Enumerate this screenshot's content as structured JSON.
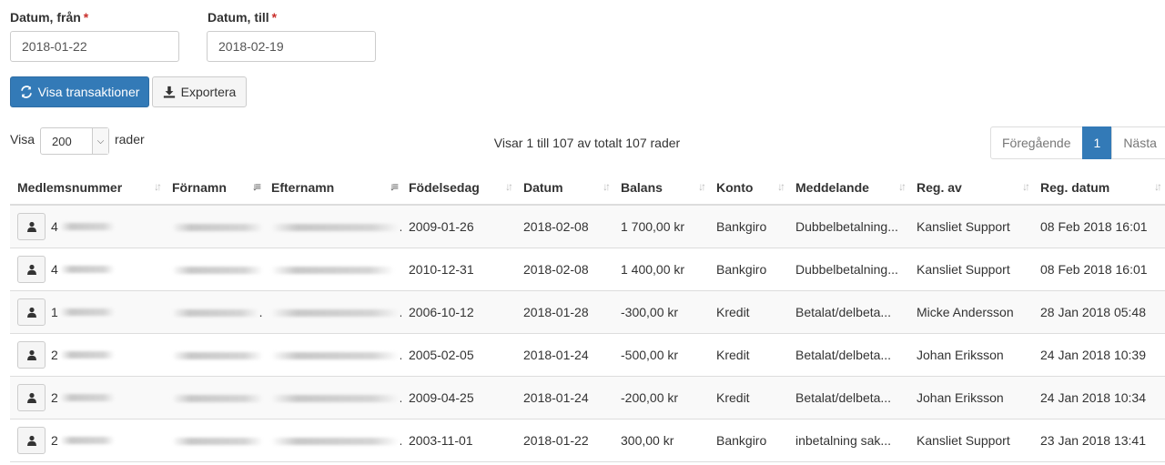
{
  "filters": {
    "from_label": "Datum, från",
    "from_value": "2018-01-22",
    "to_label": "Datum, till",
    "to_value": "2018-02-19",
    "required_mark": "*"
  },
  "actions": {
    "show_label": "Visa transaktioner",
    "export_label": "Exportera"
  },
  "table_controls": {
    "show_prefix": "Visa",
    "page_length": "200",
    "show_suffix": "rader",
    "info": "Visar 1 till 107 av totalt 107 rader",
    "prev": "Föregående",
    "page": "1",
    "next": "Nästa"
  },
  "columns": {
    "member_no": "Medlemsnummer",
    "first_name": "Förnamn",
    "last_name": "Efternamn",
    "birth_date": "Födelsedag",
    "date": "Datum",
    "balance": "Balans",
    "account": "Konto",
    "message": "Meddelande",
    "reg_by": "Reg. av",
    "reg_date": "Reg. datum"
  },
  "rows": [
    {
      "id": "4",
      "birth": "2009-01-26",
      "date": "2018-02-08",
      "balance": "1 700,00 kr",
      "account": "Bankgiro",
      "message": "Dubbelbetalning...",
      "reg_by": "Kansliet Support",
      "reg_date": "08 Feb 2018 16:01"
    },
    {
      "id": "4",
      "birth": "2010-12-31",
      "date": "2018-02-08",
      "balance": "1 400,00 kr",
      "account": "Bankgiro",
      "message": "Dubbelbetalning...",
      "reg_by": "Kansliet Support",
      "reg_date": "08 Feb 2018 16:01"
    },
    {
      "id": "1",
      "birth": "2006-10-12",
      "date": "2018-01-28",
      "balance": "-300,00 kr",
      "account": "Kredit",
      "message": "Betalat/delbeta...",
      "reg_by": "Micke Andersson",
      "reg_date": "28 Jan 2018 05:48"
    },
    {
      "id": "2",
      "birth": "2005-02-05",
      "date": "2018-01-24",
      "balance": "-500,00 kr",
      "account": "Kredit",
      "message": "Betalat/delbeta...",
      "reg_by": "Johan Eriksson",
      "reg_date": "24 Jan 2018 10:39"
    },
    {
      "id": "2",
      "birth": "2009-04-25",
      "date": "2018-01-24",
      "balance": "-200,00 kr",
      "account": "Kredit",
      "message": "Betalat/delbeta...",
      "reg_by": "Johan Eriksson",
      "reg_date": "24 Jan 2018 10:34"
    },
    {
      "id": "2",
      "birth": "2003-11-01",
      "date": "2018-01-22",
      "balance": "300,00 kr",
      "account": "Bankgiro",
      "message": "inbetalning sak...",
      "reg_by": "Kansliet Support",
      "reg_date": "23 Jan 2018 13:41"
    }
  ]
}
